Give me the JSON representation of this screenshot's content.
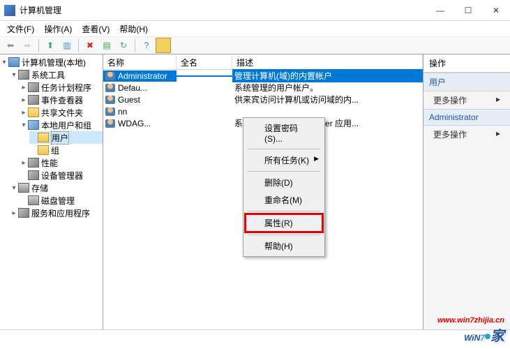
{
  "title": "计算机管理",
  "menus": [
    "文件(F)",
    "操作(A)",
    "查看(V)",
    "帮助(H)"
  ],
  "tree": {
    "root": "计算机管理(本地)",
    "sys_tools": "系统工具",
    "task_sched": "任务计划程序",
    "event_viewer": "事件查看器",
    "shared": "共享文件夹",
    "local_ug": "本地用户和组",
    "users": "用户",
    "groups": "组",
    "perf": "性能",
    "dev_mgr": "设备管理器",
    "storage": "存储",
    "disk_mgr": "磁盘管理",
    "svc_apps": "服务和应用程序"
  },
  "columns": {
    "name": "名称",
    "full": "全名",
    "desc": "描述"
  },
  "users": [
    {
      "name": "Administrator",
      "full": "",
      "desc": "管理计算机(域)的内置帐户",
      "selected": true
    },
    {
      "name": "Defau...",
      "full": "",
      "desc": "系统管理的用户帐户。"
    },
    {
      "name": "Guest",
      "full": "",
      "desc": "供来宾访问计算机或访问域的内..."
    },
    {
      "name": "nn",
      "full": "",
      "desc": ""
    },
    {
      "name": "WDAG...",
      "full": "",
      "desc": "系统为 Windows Defender 应用..."
    }
  ],
  "context_menu": {
    "set_pwd": "设置密码(S)...",
    "all_tasks": "所有任务(K)",
    "delete": "删除(D)",
    "rename": "重命名(M)",
    "properties": "属性(R)",
    "help": "帮助(H)"
  },
  "actions": {
    "header": "操作",
    "section1": "用户",
    "more1": "更多操作",
    "section2": "Administrator",
    "more2": "更多操作"
  },
  "watermark": {
    "url": "www.win7zhijia.cn",
    "brand_w": "W",
    "brand_i": "i",
    "brand_n": "N",
    "brand_7": "7",
    "brand_jia": "家"
  }
}
